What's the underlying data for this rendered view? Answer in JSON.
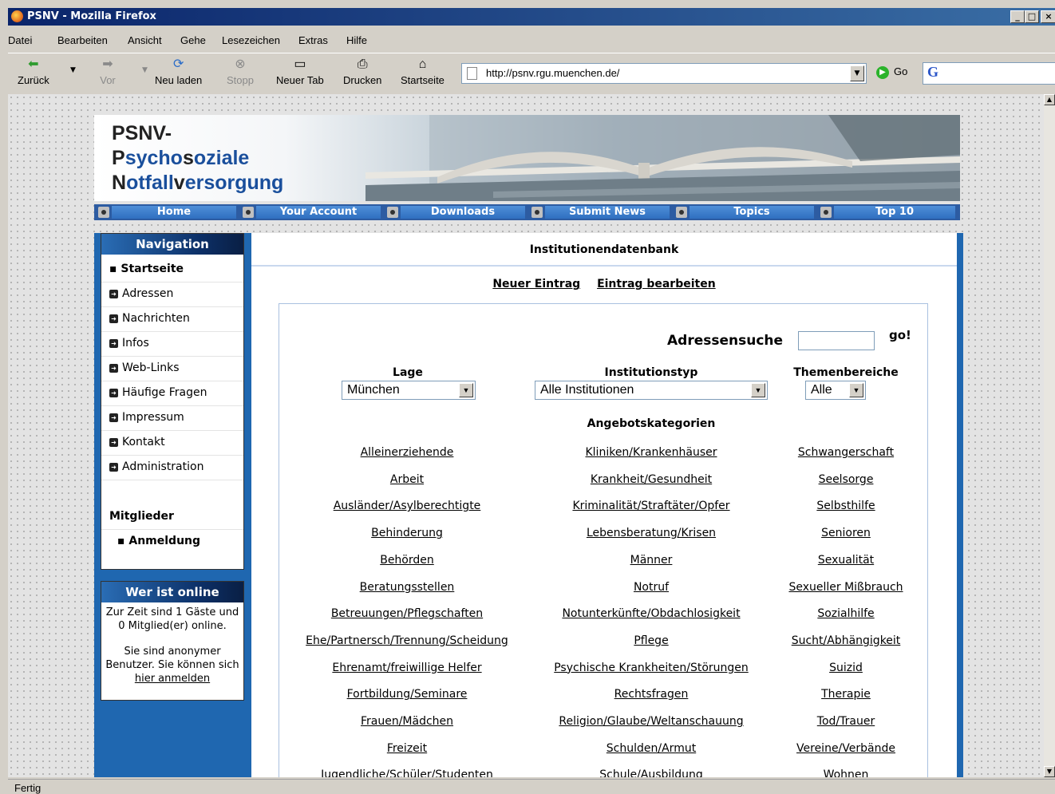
{
  "window": {
    "title": "PSNV - Mozilla Firefox"
  },
  "menu": [
    "Datei",
    "Bearbeiten",
    "Ansicht",
    "Gehe",
    "Lesezeichen",
    "Extras",
    "Hilfe"
  ],
  "toolbar": {
    "back": "Zurück",
    "forward": "Vor",
    "reload": "Neu laden",
    "stop": "Stopp",
    "newtab": "Neuer Tab",
    "print": "Drucken",
    "home": "Startseite",
    "go": "Go"
  },
  "address": {
    "url": "http://psnv.rgu.muenchen.de/"
  },
  "status": "Fertig",
  "site": {
    "logo_line1": "PSNV-",
    "logo_line2": "Psychosoziale",
    "logo_line3": "Notfallversorgung",
    "nav_tabs": [
      "Home",
      "Your Account",
      "Downloads",
      "Submit News",
      "Topics",
      "Top 10"
    ]
  },
  "sidebar": {
    "nav_title": "Navigation",
    "current": "Startseite",
    "items": [
      "Adressen",
      "Nachrichten",
      "Infos",
      "Web-Links",
      "Häufige Fragen",
      "Impressum",
      "Kontakt",
      "Administration"
    ],
    "members_title": "Mitglieder",
    "login": "Anmeldung",
    "online_title": "Wer ist online",
    "online_text1": "Zur Zeit sind 1 Gäste und 0 Mitglied(er) online.",
    "online_text2": "Sie sind anonymer Benutzer. Sie können sich",
    "online_link": "hier anmelden"
  },
  "main": {
    "title": "Institutionendatenbank",
    "new_entry": "Neuer Eintrag",
    "edit_entry": "Eintrag bearbeiten",
    "search_label": "Adressensuche",
    "search_value": "",
    "search_go": "go!",
    "filters": {
      "lage_label": "Lage",
      "lage_value": "München",
      "typ_label": "Institutionstyp",
      "typ_value": "Alle Institutionen",
      "themen_label": "Themenbereiche",
      "themen_value": "Alle"
    },
    "categories_title": "Angebotskategorien",
    "categories": {
      "col1": [
        "Alleinerziehende",
        "Arbeit",
        "Ausländer/Asylberechtigte",
        "Behinderung",
        "Behörden",
        "Beratungsstellen",
        "Betreuungen/Pflegschaften",
        "Ehe/Partnersch/Trennung/Scheidung",
        "Ehrenamt/freiwillige Helfer",
        "Fortbildung/Seminare",
        "Frauen/Mädchen",
        "Freizeit",
        "Jugendliche/Schüler/Studenten"
      ],
      "col2": [
        "Kliniken/Krankenhäuser",
        "Krankheit/Gesundheit",
        "Kriminalität/Straftäter/Opfer",
        "Lebensberatung/Krisen",
        "Männer",
        "Notruf",
        "Notunterkünfte/Obdachlosigkeit",
        "Pflege",
        "Psychische Krankheiten/Störungen",
        "Rechtsfragen",
        "Religion/Glaube/Weltanschauung",
        "Schulden/Armut",
        "Schule/Ausbildung"
      ],
      "col3": [
        "Schwangerschaft",
        "Seelsorge",
        "Selbsthilfe",
        "Senioren",
        "Sexualität",
        "Sexueller Mißbrauch",
        "Sozialhilfe",
        "Sucht/Abhängigkeit",
        "Suizid",
        "Therapie",
        "Tod/Trauer",
        "Vereine/Verbände",
        "Wohnen"
      ]
    }
  }
}
